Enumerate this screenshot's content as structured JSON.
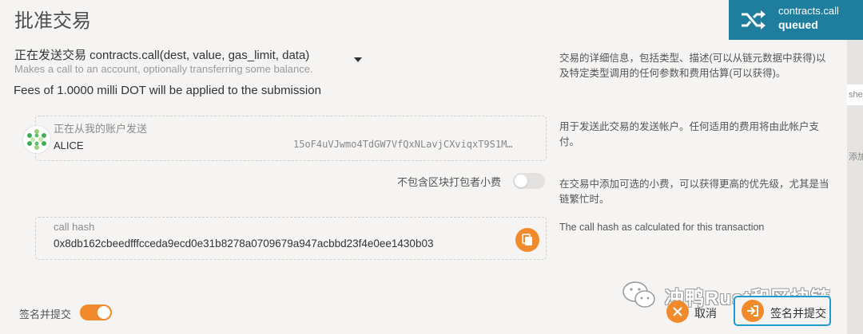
{
  "modal": {
    "title": "批准交易"
  },
  "toast": {
    "icon": "shuffle-icon",
    "method": "contracts.call",
    "status": "queued",
    "color": "#1f7e9e"
  },
  "transaction": {
    "sending_text": "正在发送交易 contracts.call(dest, value, gas_limit, data)",
    "description": "Makes a call to an account, optionally transferring some balance.",
    "help": "交易的详细信息，包括类型、描述(可以从链元数据中获得)以及特定类型调用的任何参数和费用估算(可以获得)。",
    "fees": "Fees of 1.0000 milli DOT will be applied to the submission"
  },
  "account": {
    "label": "正在从我的账户发送",
    "name": "ALICE",
    "address": "15oF4uVJwmo4TdGW7VfQxNLavjCXviqxT9S1M…",
    "help": "用于发送此交易的发送帐户。任何适用的费用将由此帐户支付。"
  },
  "tip": {
    "label": "不包含区块打包者小费",
    "enabled": false,
    "help": "在交易中添加可选的小费，可以获得更高的优先级，尤其是当链繁忙时。"
  },
  "call_hash": {
    "label": "call hash",
    "value": "0x8db162cbeedfffcceda9ecd0e31b8278a0709679a947acbbd23f4e0ee1430b03",
    "help": "The call hash as calculated for this transaction"
  },
  "footer": {
    "sign_toggle_label": "签名并提交",
    "sign_toggle_enabled": true,
    "cancel_label": "取消",
    "submit_label": "签名并提交"
  },
  "background": {
    "fragment_1": "she",
    "fragment_2": "添加"
  },
  "watermark": {
    "text": "冲鸭Rust和区块链"
  },
  "colors": {
    "accent": "#f08a2b",
    "focus": "#1f9ad0",
    "background": "#f5f4f3"
  }
}
